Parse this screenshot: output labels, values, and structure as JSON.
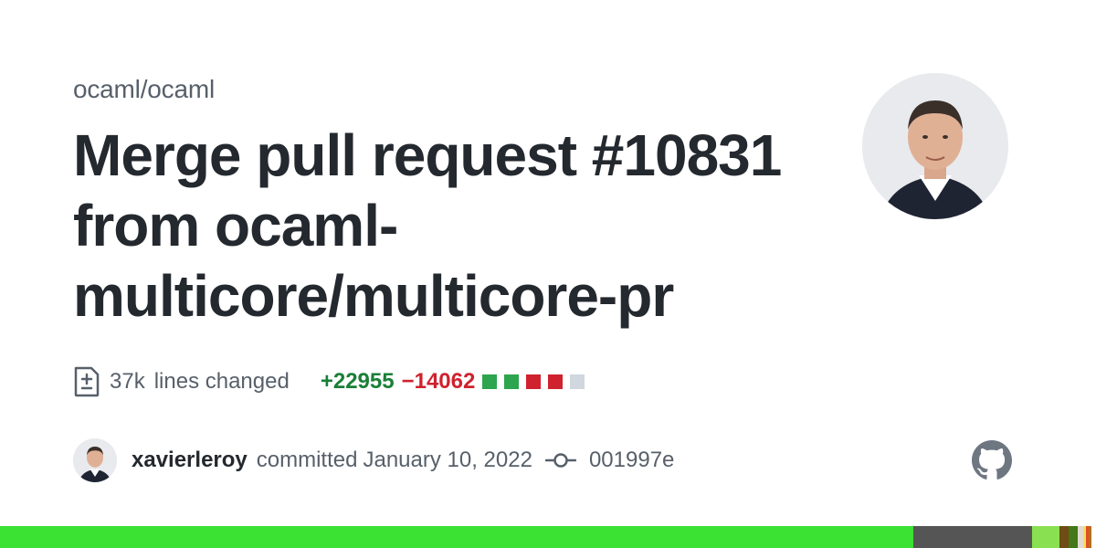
{
  "repo": "ocaml/ocaml",
  "title": "Merge pull request #10831 from ocaml-multicore/multicore-pr",
  "stats": {
    "lines_count": "37k",
    "lines_label": "lines changed",
    "additions": "+22955",
    "deletions": "−14062",
    "diff_squares": [
      "add",
      "add",
      "del",
      "del",
      "neutral"
    ]
  },
  "commit": {
    "author": "xavierleroy",
    "action": "committed",
    "date": "January 10, 2022",
    "sha": "001997e"
  },
  "icons": {
    "file_diff": "file-diff-icon",
    "commit": "git-commit-icon",
    "github": "github-logo-icon"
  },
  "colors": {
    "additions": "#1a7f37",
    "deletions": "#cf222e",
    "square_add": "#2da44e",
    "square_del": "#cf222e",
    "square_neutral": "#d0d7de"
  },
  "language_bar": [
    {
      "color": "#3be133",
      "share": 0.8333
    },
    {
      "color": "#555555",
      "share": 0.1083
    },
    {
      "color": "#89e051",
      "share": 0.025
    },
    {
      "color": "#6e4c13",
      "share": 0.0083
    },
    {
      "color": "#427819",
      "share": 0.0083
    },
    {
      "color": "#e3d9d0",
      "share": 0.005
    },
    {
      "color": "#f1e05a",
      "share": 0.0025
    },
    {
      "color": "#e34c26",
      "share": 0.0025
    },
    {
      "color": "#b07219",
      "share": 0.0025
    },
    {
      "color": "#ffffff",
      "share": 0.0043
    }
  ]
}
